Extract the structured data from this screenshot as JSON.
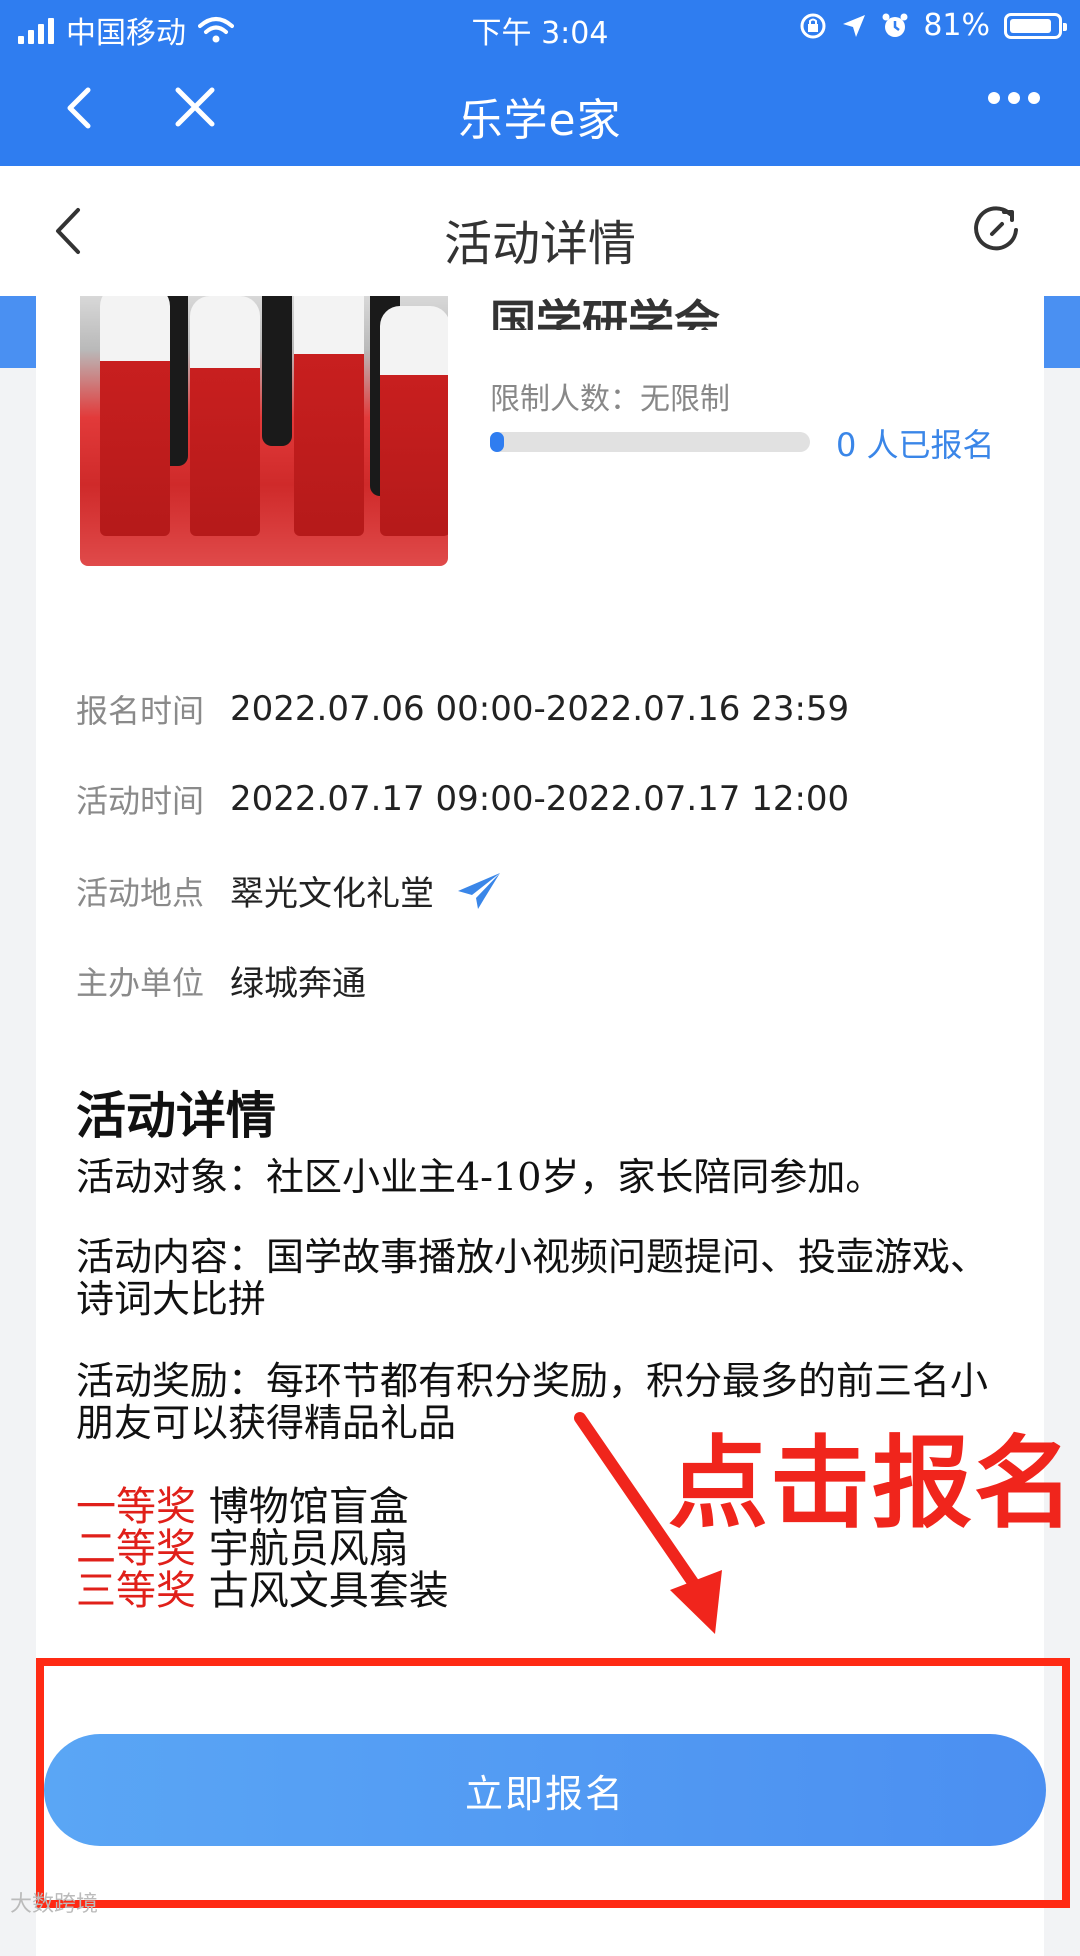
{
  "status_bar": {
    "carrier": "中国移动",
    "time": "下午 3:04",
    "battery": "81%"
  },
  "app_bar": {
    "title": "乐学e家"
  },
  "page_header": {
    "title": "活动详情"
  },
  "activity": {
    "title": "国学研学会",
    "limit": "限制人数：无限制",
    "enrolled": "0 人已报名",
    "progress": 0.045
  },
  "info": [
    {
      "key": "报名时间",
      "value": "2022.07.06 00:00-2022.07.16 23:59"
    },
    {
      "key": "活动时间",
      "value": "2022.07.17 09:00-2022.07.17 12:00"
    },
    {
      "key": "活动地点",
      "value": "翠光文化礼堂"
    },
    {
      "key": "主办单位",
      "value": "绿城奔通"
    }
  ],
  "details": {
    "heading": "活动详情",
    "target": "活动对象：社区小业主4-10岁，家长陪同参加。",
    "content": "活动内容：国学故事播放小视频问题提问、投壶游戏、诗词大比拼",
    "reward": "活动奖励：每环节都有积分奖励，积分最多的前三名小朋友可以获得精品礼品",
    "prizes": [
      {
        "rank": "一等奖",
        "item": "博物馆盲盒"
      },
      {
        "rank": "二等奖",
        "item": "宇航员风扇"
      },
      {
        "rank": "三等奖",
        "item": "古风文具套装"
      }
    ]
  },
  "annotation": "点击报名",
  "signup_button": "立即报名",
  "watermark": "大数跨境",
  "colors": {
    "brand_blue": "#2f7df0",
    "annotation_red": "#f0251c"
  }
}
